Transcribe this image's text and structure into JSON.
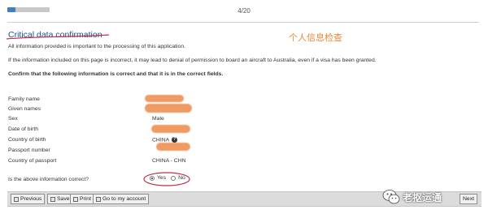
{
  "header": {
    "progress": 0.2,
    "page_indicator": "4/20"
  },
  "section": {
    "title": "Critical data confirmation",
    "annotation_cn": "个人信息检查",
    "intro": "All information provided is important to the processing of this application.",
    "warning": "If the information included on this page is incorrect, it may lead to denial of permission to board an aircraft to Australia, even if a visa has been granted.",
    "instruction": "Confirm that the following information is correct and that it is in the correct fields."
  },
  "fields": [
    {
      "label": "Family name",
      "value": ""
    },
    {
      "label": "Given names",
      "value": ""
    },
    {
      "label": "Sex",
      "value": "Male"
    },
    {
      "label": "Date of birth",
      "value": ""
    },
    {
      "label": "Country of birth",
      "value": "CHINA"
    },
    {
      "label": "Passport number",
      "value": ""
    },
    {
      "label": "Country of passport",
      "value": "CHINA - CHN"
    }
  ],
  "question": {
    "label": "Is the above information correct?",
    "yes": "Yes",
    "no": "No",
    "selected": "yes"
  },
  "footer": {
    "previous": "Previous",
    "save": "Save",
    "print": "Print",
    "account": "Go to my account",
    "next": "Next"
  },
  "watermark": {
    "text": "老抠运通"
  },
  "colors": {
    "accent": "#3d7ec4",
    "title": "#1f4e8c",
    "annotation": "#e88a3a",
    "ink": "#c0304a",
    "redaction": "#ee8a4a"
  },
  "icons": {
    "help": "question-circle-icon",
    "wechat": "wechat-icon"
  }
}
